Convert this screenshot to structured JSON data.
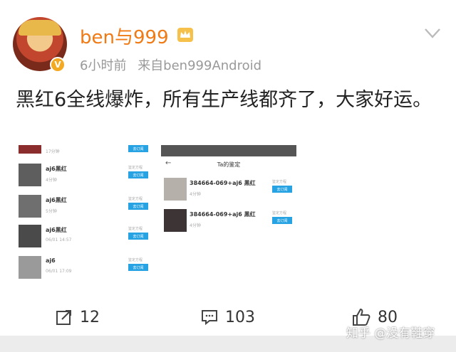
{
  "post": {
    "username": "ben与999",
    "time": "6小时前",
    "source": "来自ben999Android",
    "text": "黑红6全线爆炸，所有生产线都齐了，大家好运。"
  },
  "left_screenshot": {
    "rows": [
      {
        "label": "",
        "sub": "17分钟",
        "small": "",
        "button": "去订阅"
      },
      {
        "label": "aj6黑红",
        "sub": "4分钟",
        "small": "鉴定方程",
        "button": "去订阅"
      },
      {
        "label": "aj6黑红",
        "sub": "5分钟",
        "small": "鉴定方程",
        "button": "去订阅"
      },
      {
        "label": "aj6黑红",
        "sub": "06/01 14:57",
        "small": "鉴定方程",
        "button": "去订阅"
      },
      {
        "label": "aj6",
        "sub": "06/01 17:09",
        "small": "鉴定方程",
        "button": "去订阅"
      }
    ]
  },
  "right_screenshot": {
    "title": "Ta的鉴定",
    "rows": [
      {
        "label": "384664-069+aj6 黑红",
        "sub": "4分钟",
        "small": "鉴定方程",
        "button": "去订阅"
      },
      {
        "label": "384664-069+aj6 黑红",
        "sub": "4分钟",
        "small": "鉴定方程",
        "button": "去订阅"
      }
    ]
  },
  "actions": {
    "share_count": "12",
    "comment_count": "103",
    "like_count": "80"
  },
  "watermark": "知乎 @没有鞋穿",
  "colors": {
    "username": "#f07a14",
    "badge": "#f3a922",
    "button": "#27a3e3"
  }
}
